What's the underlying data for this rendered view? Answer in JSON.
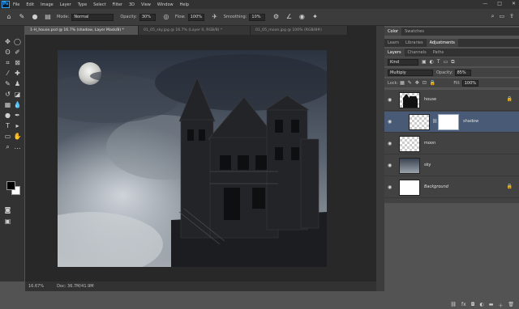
{
  "app": {
    "logo": "Ps"
  },
  "menu": [
    "File",
    "Edit",
    "Image",
    "Layer",
    "Type",
    "Select",
    "Filter",
    "3D",
    "View",
    "Window",
    "Help"
  ],
  "window_controls": [
    "—",
    "□",
    "✕"
  ],
  "options": {
    "mode_label": "Mode:",
    "mode_value": "Normal",
    "opacity_label": "Opacity:",
    "opacity_value": "30%",
    "flow_label": "Flow:",
    "flow_value": "100%",
    "smoothing_label": "Smoothing:",
    "smoothing_value": "10%"
  },
  "tabs": [
    "1-H_house.psd @ 16.7% (shadow, Layer Mask/8) *",
    "01_05_sky.jpg @ 16.7% (Layer 0, RGB/8) *",
    "01_05_moon.jpg @ 100% (RGB/8#)"
  ],
  "status": {
    "zoom": "16.67%",
    "doc": "Doc: 36.7M/41.9M"
  },
  "panels": {
    "top_tabs": [
      "Color",
      "Swatches"
    ],
    "mid_tabs": [
      "Learn",
      "Libraries",
      "Adjustments"
    ],
    "layer_tabs": [
      "Layers",
      "Channels",
      "Paths"
    ],
    "kind_label": "Kind",
    "blend_mode": "Multiply",
    "opacity_label": "Opacity:",
    "opacity_value": "85%",
    "lock_label": "Lock:",
    "fill_label": "Fill:",
    "fill_value": "100%"
  },
  "layers": [
    {
      "name": "house",
      "locked": true
    },
    {
      "name": "shadow",
      "selected": true
    },
    {
      "name": "moon"
    },
    {
      "name": "sky"
    },
    {
      "name": "Background",
      "locked": true
    }
  ],
  "colors": {
    "accent": "#31a8ff",
    "selection": "#485a75",
    "foreground": "#000000",
    "background": "#ffffff"
  }
}
